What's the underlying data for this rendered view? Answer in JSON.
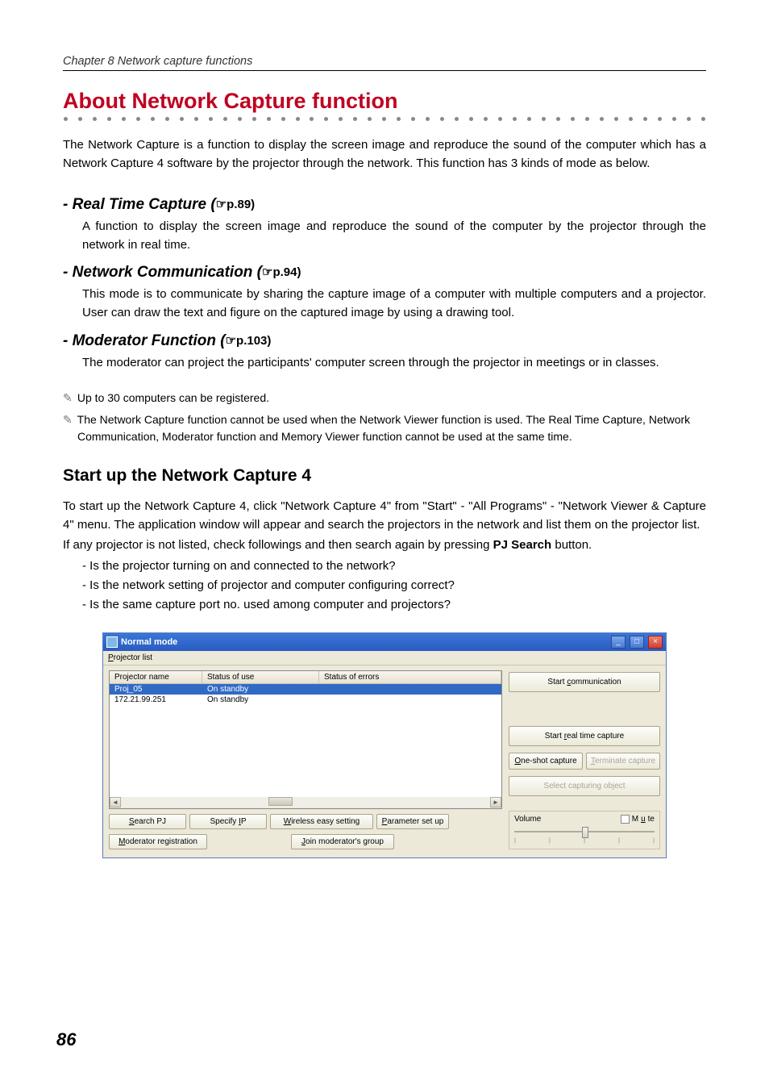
{
  "chapter_header": "Chapter 8 Network capture functions",
  "main_title": "About Network Capture function",
  "intro": "The Network Capture is a function to display the screen image and reproduce the sound of the computer which has a Network Capture 4 software by the projector through the network. This function has 3 kinds of mode as below.",
  "sub1": {
    "title": "- Real Time Capture (",
    "ref": "☞p.89)",
    "desc": " A function to display the screen image and reproduce the sound of the computer by the projector through the network in real time."
  },
  "sub2": {
    "title": "- Network Communication (",
    "ref": "☞p.94)",
    "desc": "This mode is to communicate by sharing the capture image of a computer with multiple computers and a projector. User can draw the text and figure on the captured image by using a drawing tool."
  },
  "sub3": {
    "title": "- Moderator Function (",
    "ref": "☞p.103)",
    "desc": "The moderator can project the participants' computer screen through the projector in meetings or in classes."
  },
  "note1": "Up to 30 computers can be registered.",
  "note2": "The Network  Capture function cannot be used when the Network Viewer function is used. The Real Time Capture, Network Communication, Moderator function and Memory Viewer function cannot be used at the same time.",
  "section_title": "Start up the Network Capture 4",
  "body1": "To start up the Network Capture 4, click \"Network Capture 4\" from \"Start\" - \"All Programs\" - \"Network Viewer & Capture 4\" menu. The application window will appear and search the projectors in the network and list them on the projector list.",
  "body2_a": "If any projector is not listed, check followings and then search again by pressing ",
  "body2_b": "PJ Search",
  "body2_c": " button.",
  "check1": "- Is the projector turning on and connected to the network?",
  "check2": "- Is the network setting of projector and computer configuring correct?",
  "check3": "- Is the same capture port no. used among computer and projectors?",
  "page_number": "86",
  "win": {
    "title": "Normal mode",
    "menu": "Projector list",
    "cols": {
      "c1": "Projector name",
      "c2": "Status of use",
      "c3": "Status of errors"
    },
    "rows": [
      {
        "name": "Proj_05",
        "status": "On standby"
      },
      {
        "name": "172.21.99.251",
        "status": "On standby"
      }
    ],
    "btns": {
      "search": "Search PJ",
      "specify": "Specify IP",
      "wireless": "Wireless easy setting",
      "param": "Parameter set up",
      "modreg": "Moderator registration",
      "join": "Join moderator's group",
      "startcomm": "Start communication",
      "startreal": "Start real time capture",
      "oneshot": "One-shot capture",
      "terminate": "Terminate capture",
      "selectobj": "Select capturing object"
    },
    "vol": {
      "label": "Volume",
      "mute": "Mute"
    }
  }
}
